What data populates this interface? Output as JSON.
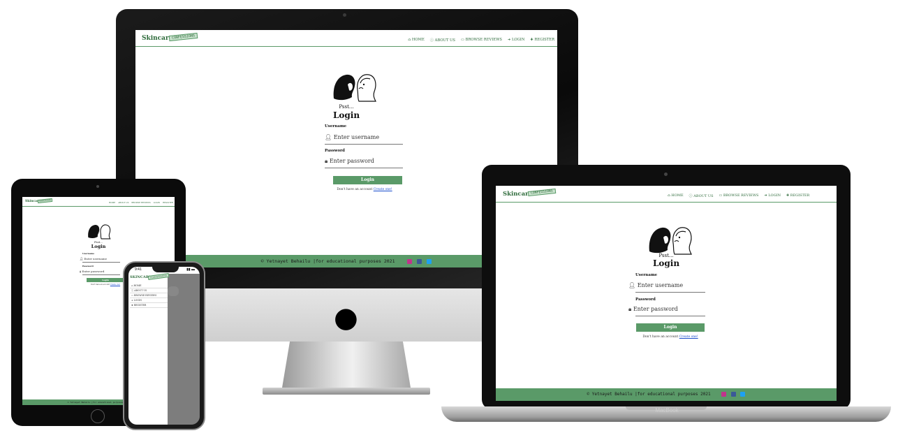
{
  "site": {
    "brand": "Skincare",
    "brand_upper": "SKINCARE",
    "stamp": "CONFESSIONS",
    "nav": [
      "HOME",
      "ABOUT US",
      "BROWSE REVIEWS",
      "LOGIN",
      "REGISTER"
    ],
    "nav_icons": [
      "home-icon",
      "info-icon",
      "comment-icon",
      "sign-in-icon",
      "user-plus-icon"
    ],
    "caption": "Psst...",
    "heading": "Login",
    "username_label": "Username",
    "username_placeholder": "Enter username",
    "password_label": "Password",
    "password_placeholder": "Enter password",
    "button": "Login",
    "signup_prompt": "Don't have an account",
    "signup_link": "Create one!",
    "footer": "© Yetnayet Behailu |for educational purposes 2021",
    "social_icons": [
      "instagram-icon",
      "facebook-icon",
      "twitter-icon"
    ]
  },
  "phone": {
    "time": "9:41"
  },
  "laptop": {
    "brand": "MacBook"
  },
  "colors": {
    "accent": "#5a9a68",
    "brand_text": "#2e6b3b",
    "link": "#1a4dcc"
  }
}
